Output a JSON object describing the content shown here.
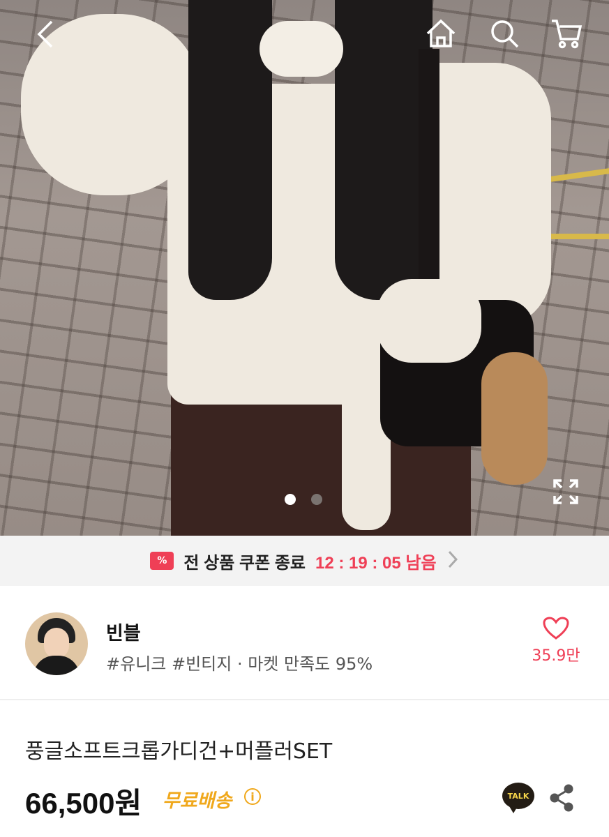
{
  "hero": {
    "back_icon": "chevron-left-icon",
    "home_icon": "home-icon",
    "search_icon": "search-icon",
    "cart_icon": "cart-icon",
    "expand_icon": "expand-icon",
    "slides_total": 2,
    "slide_active": 1
  },
  "coupon": {
    "badge": "%",
    "text": "전 상품 쿠폰 종료",
    "timer": "12 : 19 : 05 남음"
  },
  "shop": {
    "name": "빈블",
    "tags": "#유니크 #빈티지 · 마켓 만족도 95%",
    "likes": "35.9만"
  },
  "product": {
    "title": "풍글소프트크롭가디건+머플러SET",
    "price": "66,500원",
    "shipping": "무료배송",
    "info": "i",
    "talk": "TALK"
  },
  "colors": {
    "accent": "#ef3f56",
    "shipping": "#f0a81c"
  }
}
